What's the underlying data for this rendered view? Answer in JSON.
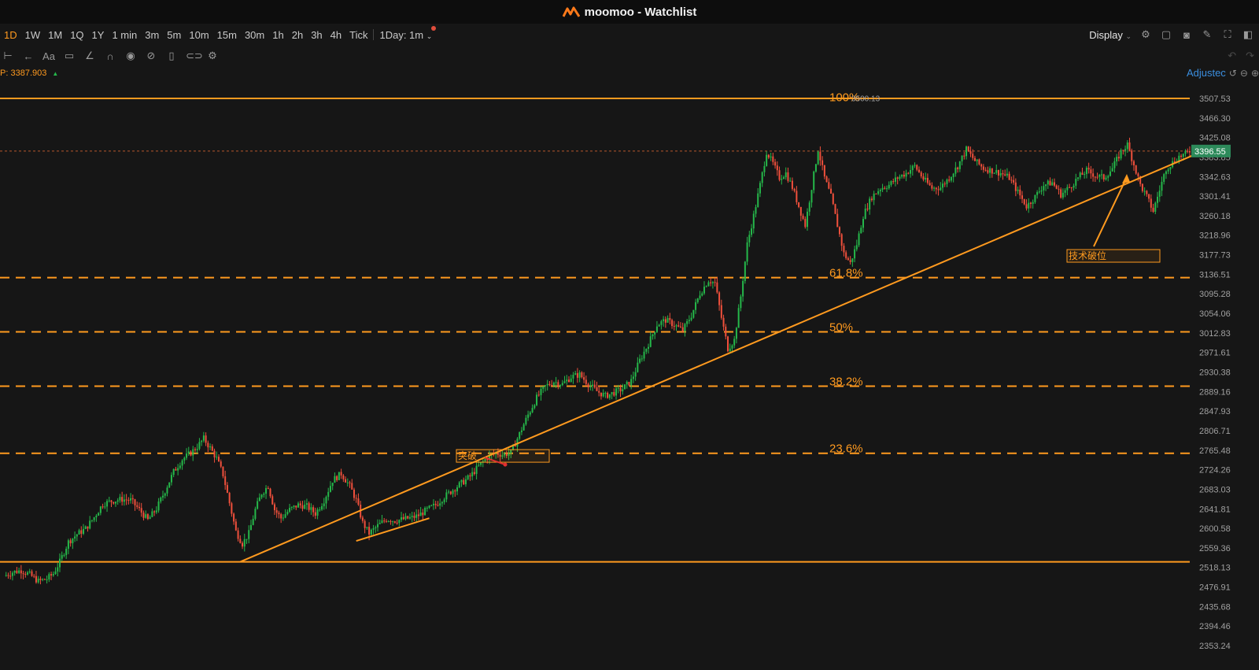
{
  "window": {
    "app_name": "moomoo",
    "title": "moomoo - Watchlist"
  },
  "toolbar": {
    "timeframes": [
      "1D",
      "1W",
      "1M",
      "1Q",
      "1Y",
      "1 min",
      "3m",
      "5m",
      "10m",
      "15m",
      "30m",
      "1h",
      "2h",
      "3h",
      "4h",
      "Tick"
    ],
    "active_timeframe": "1D",
    "interval_label": "1Day: 1m",
    "display_label": "Display"
  },
  "drawing_tools": [
    "crosshair-icon",
    "back-arrow-icon",
    "text-icon",
    "comment-icon",
    "pen-icon",
    "magnet-icon",
    "eye-icon",
    "hide-icon",
    "trash-icon",
    "link-icon",
    "settings-icon"
  ],
  "price_info": {
    "label": "P:",
    "value": "3387.903"
  },
  "adjust_label": "Adjustec",
  "colors": {
    "up": "#25b84a",
    "down": "#f0503c",
    "accent": "#ff9a1f",
    "background": "#161616",
    "current_price_bg": "#2d8a5a"
  },
  "chart_data": {
    "type": "candlestick",
    "title": "",
    "xlabel": "",
    "ylabel": "",
    "ylim": [
      2341,
      3537
    ],
    "grid": false,
    "y_ticks": [
      "3507.53",
      "3466.30",
      "3425.08",
      "3383.85",
      "3342.63",
      "3301.41",
      "3260.18",
      "3218.96",
      "3177.73",
      "3136.51",
      "3095.28",
      "3054.06",
      "3012.83",
      "2971.61",
      "2930.38",
      "2889.16",
      "2847.93",
      "2806.71",
      "2765.48",
      "2724.26",
      "2683.03",
      "2641.81",
      "2600.58",
      "2559.36",
      "2518.13",
      "2476.91",
      "2435.68",
      "2394.46",
      "2353.24"
    ],
    "close_path": [
      [
        0,
        2500
      ],
      [
        4,
        2508
      ],
      [
        8,
        2512
      ],
      [
        12,
        2503
      ],
      [
        16,
        2489
      ],
      [
        20,
        2494
      ],
      [
        23,
        2505
      ],
      [
        26,
        2530
      ],
      [
        30,
        2572
      ],
      [
        34,
        2588
      ],
      [
        38,
        2600
      ],
      [
        42,
        2624
      ],
      [
        46,
        2652
      ],
      [
        50,
        2658
      ],
      [
        55,
        2662
      ],
      [
        59,
        2660
      ],
      [
        63,
        2640
      ],
      [
        67,
        2618
      ],
      [
        71,
        2642
      ],
      [
        75,
        2680
      ],
      [
        79,
        2720
      ],
      [
        83,
        2746
      ],
      [
        87,
        2760
      ],
      [
        90,
        2773
      ],
      [
        93,
        2790
      ],
      [
        96,
        2770
      ],
      [
        99,
        2748
      ],
      [
        102,
        2714
      ],
      [
        105,
        2654
      ],
      [
        108,
        2594
      ],
      [
        111,
        2568
      ],
      [
        114,
        2590
      ],
      [
        117,
        2640
      ],
      [
        120,
        2675
      ],
      [
        123,
        2690
      ],
      [
        126,
        2640
      ],
      [
        129,
        2622
      ],
      [
        133,
        2640
      ],
      [
        137,
        2650
      ],
      [
        141,
        2647
      ],
      [
        145,
        2632
      ],
      [
        149,
        2660
      ],
      [
        153,
        2702
      ],
      [
        157,
        2716
      ],
      [
        161,
        2690
      ],
      [
        164,
        2660
      ],
      [
        167,
        2612
      ],
      [
        170,
        2590
      ],
      [
        174,
        2606
      ],
      [
        178,
        2620
      ],
      [
        182,
        2617
      ],
      [
        186,
        2620
      ],
      [
        190,
        2623
      ],
      [
        193,
        2628
      ],
      [
        197,
        2640
      ],
      [
        201,
        2650
      ],
      [
        205,
        2667
      ],
      [
        209,
        2682
      ],
      [
        213,
        2696
      ],
      [
        217,
        2710
      ],
      [
        221,
        2732
      ],
      [
        225,
        2750
      ],
      [
        229,
        2760
      ],
      [
        232,
        2756
      ],
      [
        236,
        2760
      ],
      [
        240,
        2800
      ],
      [
        244,
        2840
      ],
      [
        248,
        2876
      ],
      [
        252,
        2900
      ],
      [
        256,
        2910
      ],
      [
        260,
        2905
      ],
      [
        264,
        2920
      ],
      [
        268,
        2925
      ],
      [
        272,
        2905
      ],
      [
        276,
        2890
      ],
      [
        280,
        2880
      ],
      [
        284,
        2887
      ],
      [
        288,
        2895
      ],
      [
        292,
        2912
      ],
      [
        296,
        2955
      ],
      [
        300,
        2990
      ],
      [
        304,
        3030
      ],
      [
        308,
        3040
      ],
      [
        312,
        3030
      ],
      [
        316,
        3018
      ],
      [
        320,
        3050
      ],
      [
        324,
        3096
      ],
      [
        328,
        3124
      ],
      [
        331,
        3118
      ],
      [
        334,
        3045
      ],
      [
        337,
        2980
      ],
      [
        340,
        2998
      ],
      [
        343,
        3090
      ],
      [
        346,
        3200
      ],
      [
        349,
        3260
      ],
      [
        352,
        3325
      ],
      [
        355,
        3395
      ],
      [
        358,
        3370
      ],
      [
        361,
        3340
      ],
      [
        364,
        3350
      ],
      [
        367,
        3320
      ],
      [
        370,
        3280
      ],
      [
        373,
        3240
      ],
      [
        376,
        3320
      ],
      [
        379,
        3400
      ],
      [
        382,
        3340
      ],
      [
        385,
        3300
      ],
      [
        388,
        3240
      ],
      [
        391,
        3180
      ],
      [
        394,
        3160
      ],
      [
        397,
        3200
      ],
      [
        400,
        3260
      ],
      [
        404,
        3300
      ],
      [
        408,
        3318
      ],
      [
        412,
        3325
      ],
      [
        416,
        3340
      ],
      [
        420,
        3350
      ],
      [
        424,
        3365
      ],
      [
        428,
        3338
      ],
      [
        432,
        3318
      ],
      [
        436,
        3320
      ],
      [
        440,
        3340
      ],
      [
        444,
        3365
      ],
      [
        448,
        3400
      ],
      [
        452,
        3376
      ],
      [
        456,
        3360
      ],
      [
        460,
        3355
      ],
      [
        464,
        3350
      ],
      [
        468,
        3340
      ],
      [
        472,
        3310
      ],
      [
        476,
        3280
      ],
      [
        480,
        3300
      ],
      [
        484,
        3325
      ],
      [
        488,
        3330
      ],
      [
        492,
        3305
      ],
      [
        496,
        3320
      ],
      [
        500,
        3340
      ],
      [
        504,
        3355
      ],
      [
        508,
        3345
      ],
      [
        512,
        3340
      ],
      [
        516,
        3360
      ],
      [
        520,
        3395
      ],
      [
        523,
        3410
      ],
      [
        526,
        3368
      ],
      [
        529,
        3325
      ],
      [
        532,
        3300
      ],
      [
        535,
        3270
      ],
      [
        538,
        3315
      ],
      [
        541,
        3360
      ],
      [
        544,
        3372
      ],
      [
        547,
        3385
      ],
      [
        550,
        3390
      ],
      [
        552,
        3396.55
      ]
    ],
    "annotations": {
      "horizontal_lines": [
        3507.53,
        2530
      ],
      "fibonacci": {
        "high": 3500.13,
        "low": 2530,
        "levels": [
          "100%",
          "61.8%",
          "50%",
          "38.2%",
          "23.6%"
        ]
      },
      "trendlines": [
        {
          "start": [
            110,
            2530
          ],
          "end": [
            560,
            3400
          ]
        },
        {
          "start": [
            164,
            2574
          ],
          "end": [
            198,
            2622
          ]
        }
      ],
      "high_label": "3500.13",
      "current_price": "3396.55",
      "text_boxes": [
        "突破",
        "技术破位"
      ]
    }
  }
}
